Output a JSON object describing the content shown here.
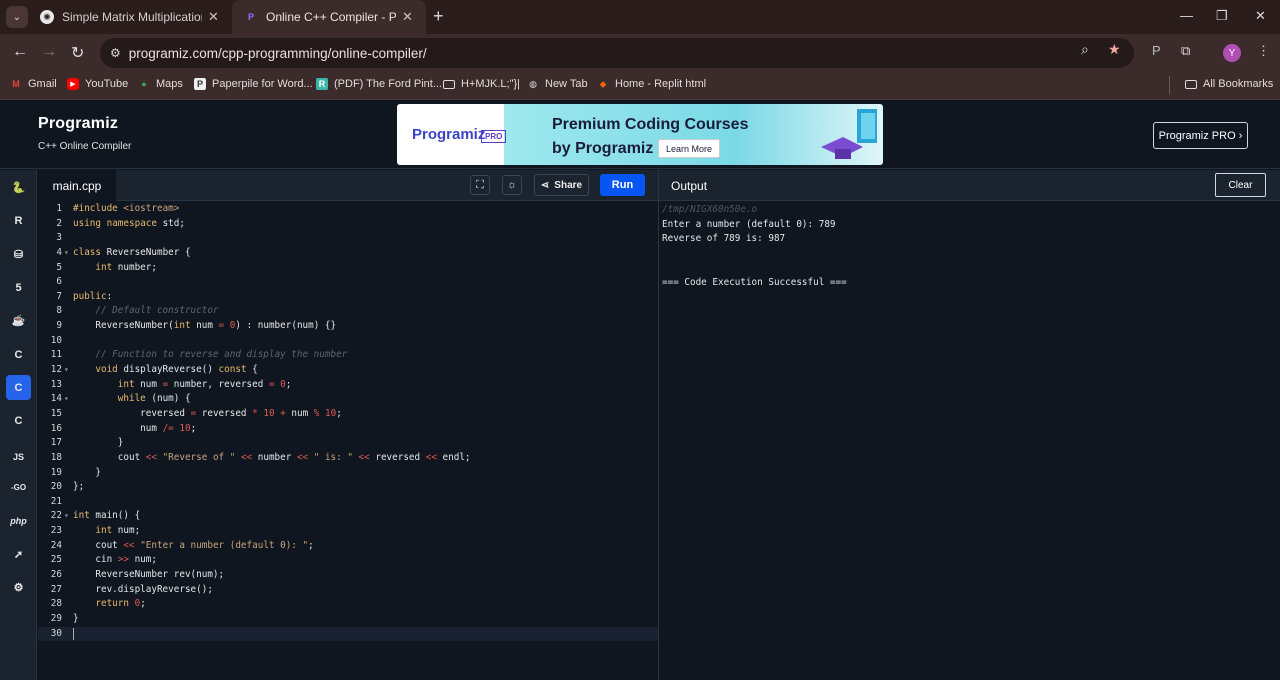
{
  "browser": {
    "tabs": [
      {
        "title": "Simple Matrix Multiplication",
        "active": false
      },
      {
        "title": "Online C++ Compiler - Programiz",
        "active": true
      }
    ],
    "url": "programiz.com/cpp-programming/online-compiler/",
    "avatar_letter": "Y",
    "bookmarks": [
      {
        "label": "Gmail",
        "icon": "gmail-icon"
      },
      {
        "label": "YouTube",
        "icon": "youtube-icon"
      },
      {
        "label": "Maps",
        "icon": "maps-icon"
      },
      {
        "label": "Paperpile for Word...",
        "icon": "paperpile-icon"
      },
      {
        "label": "(PDF) The Ford Pint...",
        "icon": "researchgate-icon"
      },
      {
        "label": "H+MJK.L;\"}|",
        "icon": "folder-icon"
      },
      {
        "label": "New Tab",
        "icon": "globe-icon"
      },
      {
        "label": "Home - Replit html",
        "icon": "replit-icon"
      }
    ],
    "all_bookmarks": "All Bookmarks"
  },
  "header": {
    "logo": "Programiz",
    "subtitle": "C++ Online Compiler",
    "banner": {
      "logo": "Programiz",
      "badge": "PRO",
      "line1": "Premium Coding Courses",
      "line2": "by Programiz",
      "cta": "Learn More"
    },
    "pro_button": "Programiz PRO ›"
  },
  "sidebar": {
    "languages": [
      "python",
      "r",
      "sql",
      "html",
      "java",
      "c",
      "cpp",
      "csharp",
      "javascript",
      "go",
      "php",
      "swift",
      "rust"
    ],
    "active": "cpp",
    "labels": {
      "javascript": "JS",
      "go": "-GO",
      "php": "php"
    }
  },
  "editor": {
    "filename": "main.cpp",
    "share_label": "Share",
    "run_label": "Run",
    "lines": [
      "#include <iostream>",
      "using namespace std;",
      "",
      "class ReverseNumber {",
      "    int number;",
      "",
      "public:",
      "    // Default constructor",
      "    ReverseNumber(int num = 0) : number(num) {}",
      "",
      "    // Function to reverse and display the number",
      "    void displayReverse() const {",
      "        int num = number, reversed = 0;",
      "        while (num) {",
      "            reversed = reversed * 10 + num % 10;",
      "            num /= 10;",
      "        }",
      "        cout << \"Reverse of \" << number << \" is: \" << reversed << endl;",
      "    }",
      "};",
      "",
      "int main() {",
      "    int num;",
      "    cout << \"Enter a number (default 0): \";",
      "    cin >> num;",
      "    ReverseNumber rev(num);",
      "    rev.displayReverse();",
      "    return 0;",
      "}",
      ""
    ],
    "fold_lines": [
      4,
      12,
      14,
      22
    ],
    "current_line": 30
  },
  "output": {
    "title": "Output",
    "clear_label": "Clear",
    "lines": [
      {
        "text": "/tmp/NIGX60n50e.o",
        "dim": true
      },
      {
        "text": "Enter a number (default 0): 789",
        "dim": false
      },
      {
        "text": "Reverse of 789 is: 987",
        "dim": false
      },
      {
        "text": "",
        "dim": false
      },
      {
        "text": "",
        "dim": false
      },
      {
        "text": "=== Code Execution Successful ===",
        "dim": false
      }
    ]
  }
}
